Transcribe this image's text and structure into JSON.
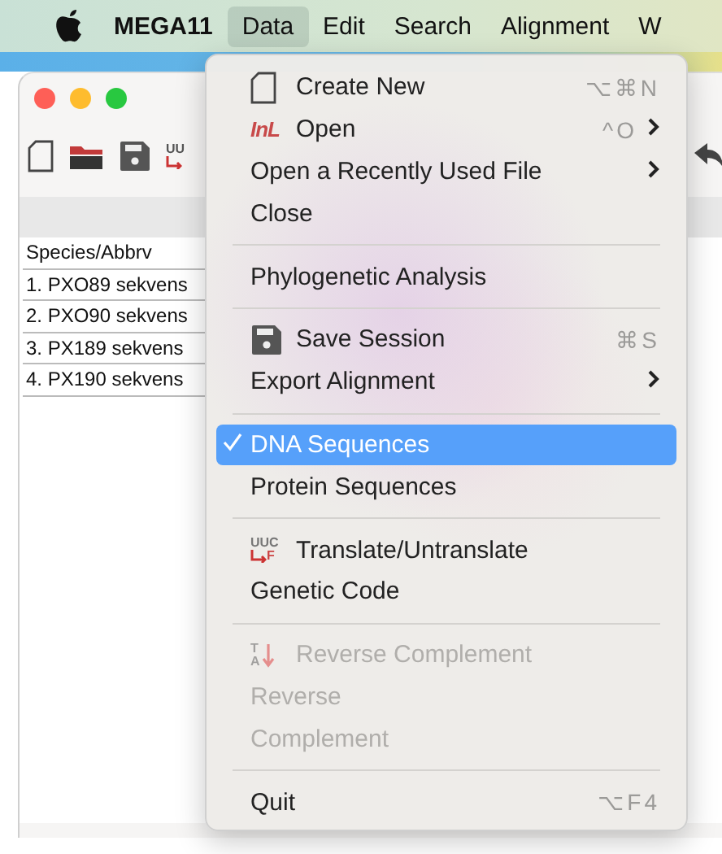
{
  "menu_bar": {
    "app_name": "MEGA11",
    "items": [
      {
        "label": "Data",
        "selected": true
      },
      {
        "label": "Edit",
        "selected": false
      },
      {
        "label": "Search",
        "selected": false
      },
      {
        "label": "Alignment",
        "selected": false
      },
      {
        "label": "W",
        "selected": false
      }
    ]
  },
  "toolbar": [
    {
      "kind": "document"
    },
    {
      "kind": "folder"
    },
    {
      "kind": "save"
    },
    {
      "kind": "translate",
      "text": "UU"
    },
    {
      "kind": "undo"
    }
  ],
  "sequence_list": {
    "header": "Species/Abbrv",
    "rows": [
      "1. PXO89 sekvens",
      "2. PXO90 sekvens",
      "3. PX189 sekvens",
      "4. PX190 sekvens"
    ]
  },
  "data_menu": [
    {
      "kind": "document",
      "label": "Create New",
      "shortcut": "⌥⌘N",
      "submenu": false,
      "checked": false,
      "disabled": false,
      "selected": false
    },
    {
      "kind": "logo",
      "label": "Open",
      "icon_text": "InL",
      "shortcut": "^O",
      "submenu": true,
      "checked": false,
      "disabled": false,
      "selected": false
    },
    {
      "kind": "item",
      "label": "Open a Recently Used File",
      "submenu": true,
      "checked": false,
      "disabled": false,
      "selected": false
    },
    {
      "kind": "item",
      "label": "Close",
      "submenu": false,
      "checked": false,
      "disabled": false,
      "selected": false
    },
    {
      "kind": "separator"
    },
    {
      "kind": "item",
      "label": "Phylogenetic Analysis",
      "submenu": false,
      "checked": false,
      "disabled": false,
      "selected": false
    },
    {
      "kind": "separator"
    },
    {
      "kind": "save",
      "label": "Save Session",
      "shortcut": "⌘S",
      "submenu": false,
      "checked": false,
      "disabled": false,
      "selected": false
    },
    {
      "kind": "item",
      "label": "Export Alignment",
      "submenu": true,
      "checked": false,
      "disabled": false,
      "selected": false
    },
    {
      "kind": "separator"
    },
    {
      "kind": "item",
      "label": "DNA Sequences",
      "submenu": false,
      "checked": true,
      "disabled": false,
      "selected": true
    },
    {
      "kind": "item",
      "label": "Protein Sequences",
      "submenu": false,
      "checked": false,
      "disabled": false,
      "selected": false
    },
    {
      "kind": "separator"
    },
    {
      "kind": "translate",
      "label": "Translate/Untranslate",
      "icon_text": "UUC",
      "icon_text_2": "F",
      "submenu": false,
      "checked": false,
      "disabled": false,
      "selected": false
    },
    {
      "kind": "item",
      "label": "Genetic Code",
      "submenu": false,
      "checked": false,
      "disabled": false,
      "selected": false
    },
    {
      "kind": "separator"
    },
    {
      "kind": "reverse",
      "label": "Reverse Complement",
      "icon_text": "T",
      "icon_text_2": "A",
      "submenu": false,
      "checked": false,
      "disabled": true,
      "selected": false
    },
    {
      "kind": "item",
      "label": "Reverse",
      "submenu": false,
      "checked": false,
      "disabled": true,
      "selected": false
    },
    {
      "kind": "item",
      "label": "Complement",
      "submenu": false,
      "checked": false,
      "disabled": true,
      "selected": false
    },
    {
      "kind": "separator"
    },
    {
      "kind": "item",
      "label": "Quit",
      "shortcut": "⌥F4",
      "submenu": false,
      "checked": false,
      "disabled": false,
      "selected": false
    }
  ]
}
